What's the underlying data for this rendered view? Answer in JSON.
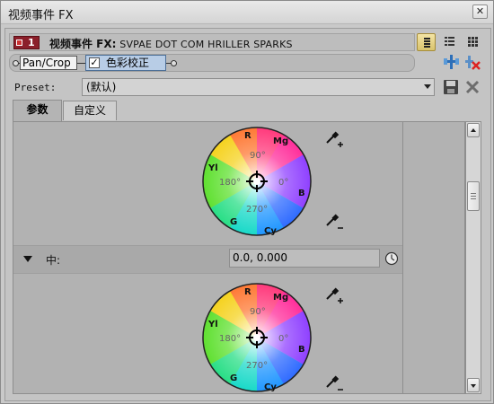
{
  "window": {
    "title": "视频事件 FX",
    "close_label": "✕"
  },
  "header": {
    "badge_number": "1",
    "fx_label": "视频事件 FX:",
    "fx_name": "SVPAE DOT COM HRILLER SPARKS"
  },
  "chain": {
    "items": [
      "Pan/Crop",
      "色彩校正"
    ],
    "checked": true
  },
  "preset": {
    "label": "Preset:",
    "value": "(默认)"
  },
  "tabs": [
    {
      "label": "参数",
      "active": true
    },
    {
      "label": "自定义",
      "active": false
    }
  ],
  "section": {
    "label": "中:",
    "value": "0.0, 0.000"
  },
  "wheel_labels": {
    "r": "R",
    "mg": "Mg",
    "b": "B",
    "cy": "Cy",
    "g": "G",
    "yl": "Yl",
    "deg90": "90°",
    "deg180": "180°",
    "deg0": "0°",
    "deg270": "270°"
  },
  "colors": {
    "badge": "#8b1f2a",
    "active_chain_item": "#b8cde6",
    "active_view_button": "#e0c96f"
  },
  "icons": [
    "detail-view-icon",
    "list-view-icon",
    "grid-view-icon",
    "chain-reorder-icon",
    "remove-fx-icon",
    "save-preset-icon",
    "delete-preset-icon",
    "eyedropper-plus-icon",
    "eyedropper-minus-icon",
    "keyframe-clock-icon"
  ]
}
